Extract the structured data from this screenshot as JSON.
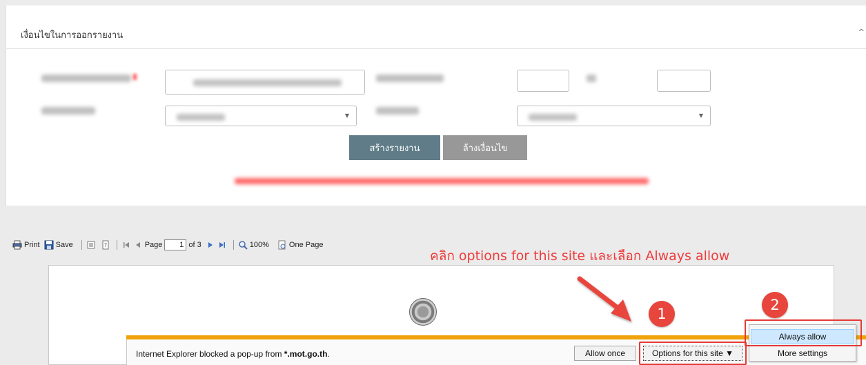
{
  "panel": {
    "title": "เงื่อนไขในการออกรายงาน",
    "collapse_glyph": "^"
  },
  "buttons": {
    "create_report": "สร้างรายงาน",
    "clear_conditions": "ล้างเงื่อนไข"
  },
  "report_toolbar": {
    "print_label": "Print",
    "save_label": "Save",
    "page_label": "Page",
    "page_value": "1",
    "page_total": "of 3",
    "zoom_label": "100%",
    "view_mode_label": "One Page",
    "icons": [
      "printer-icon",
      "floppy-icon",
      "document-map-icon",
      "help-icon",
      "first-page-icon",
      "prev-page-icon",
      "next-page-icon",
      "last-page-icon",
      "magnifier-icon",
      "one-page-icon"
    ]
  },
  "annotation": {
    "text": "คลิก options for this site และเลือก Always allow",
    "step1": "1",
    "step2": "2",
    "color": "#ee3b3b"
  },
  "ie_notification": {
    "message_prefix": "Internet Explorer blocked a pop-up from ",
    "message_domain": "*.mot.go.th",
    "message_suffix": ".",
    "allow_once_label": "Allow once",
    "options_label": "Options for this site ▼"
  },
  "options_menu": {
    "items": [
      "Always allow",
      "More settings"
    ]
  },
  "colors": {
    "create_button": "#5f7c88",
    "clear_button": "#989898",
    "ie_accent": "#f0a30a",
    "highlight_box": "#e53935"
  }
}
